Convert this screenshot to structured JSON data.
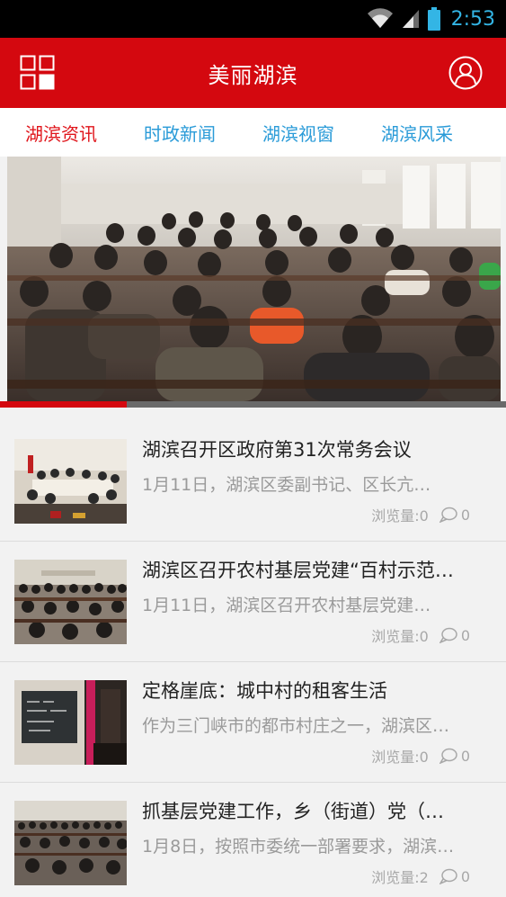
{
  "status_bar": {
    "time": "2:53"
  },
  "header": {
    "title": "美丽湖滨"
  },
  "tabs": [
    {
      "label": "湖滨资讯",
      "active": true
    },
    {
      "label": "时政新闻",
      "active": false
    },
    {
      "label": "湖滨视窗",
      "active": false
    },
    {
      "label": "湖滨风采",
      "active": false
    }
  ],
  "banner": {
    "progress": 0.25
  },
  "news": [
    {
      "title": "湖滨召开区政府第31次常务会议",
      "summary": "1月11日，湖滨区委副书记、区长亢…",
      "views": "浏览量:0",
      "comments": "0"
    },
    {
      "title": "湖滨区召开农村基层党建“百村示范…",
      "summary": "1月11日，湖滨区召开农村基层党建…",
      "views": "浏览量:0",
      "comments": "0"
    },
    {
      "title": "定格崖底：城中村的租客生活",
      "summary": "作为三门峡市的都市村庄之一，湖滨区…",
      "views": "浏览量:0",
      "comments": "0"
    },
    {
      "title": "抓基层党建工作，乡（街道）党（…",
      "summary": "1月8日，按照市委统一部署要求，湖滨…",
      "views": "浏览量:2",
      "comments": "0"
    }
  ],
  "colors": {
    "brand_red": "#d4080f",
    "tab_active": "#e0151b",
    "tab_inactive": "#2a9bd8",
    "status_time": "#33b5e5"
  }
}
